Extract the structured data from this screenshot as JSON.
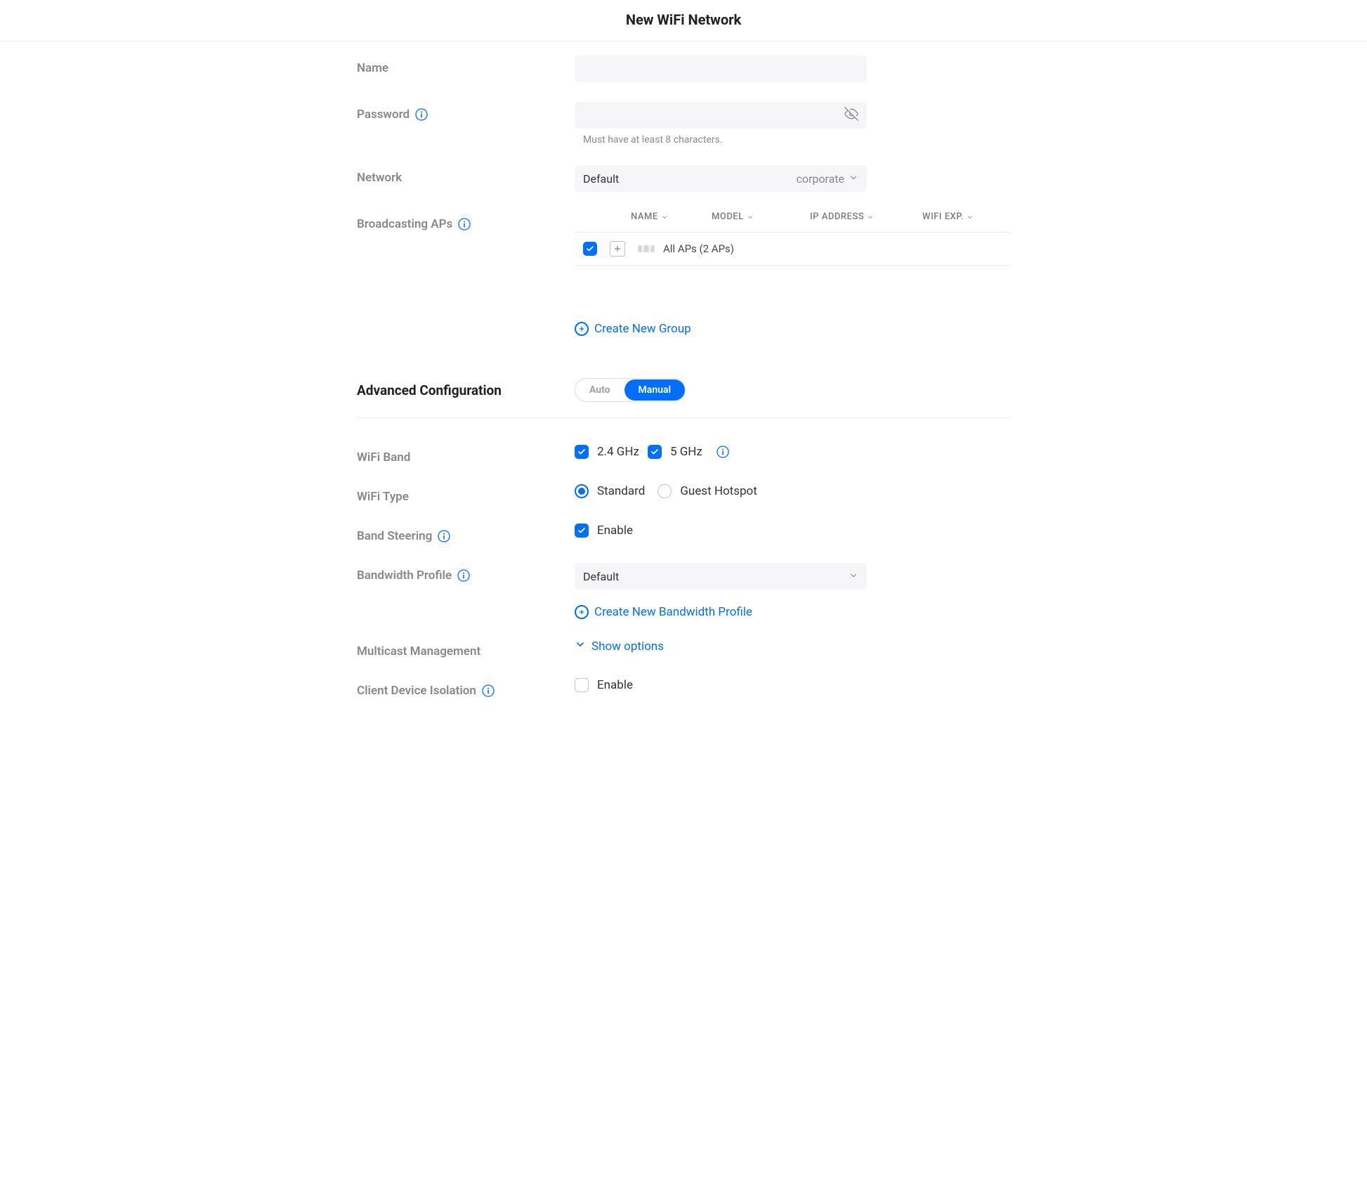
{
  "header": {
    "title": "New WiFi Network"
  },
  "labels": {
    "name": "Name",
    "password": "Password",
    "network": "Network",
    "broadcasting_aps": "Broadcasting APs",
    "advanced_config": "Advanced Configuration",
    "wifi_band": "WiFi Band",
    "wifi_type": "WiFi Type",
    "band_steering": "Band Steering",
    "bandwidth_profile": "Bandwidth Profile",
    "multicast": "Multicast Management",
    "client_isolation": "Client Device Isolation"
  },
  "name": {
    "value": ""
  },
  "password": {
    "value": "",
    "helper": "Must have at least 8 characters."
  },
  "network": {
    "value": "Default",
    "tag": "corporate"
  },
  "aps": {
    "columns": {
      "name": "NAME",
      "model": "MODEL",
      "ip": "IP ADDRESS",
      "exp": "WIFI EXP."
    },
    "all_label": "All APs (2 APs)",
    "create_group": "Create New Group"
  },
  "adv_mode": {
    "auto": "Auto",
    "manual": "Manual"
  },
  "wifi_band": {
    "b24": "2.4 GHz",
    "b5": "5 GHz"
  },
  "wifi_type": {
    "standard": "Standard",
    "guest": "Guest Hotspot"
  },
  "enable_label": "Enable",
  "bandwidth": {
    "value": "Default",
    "create_new": "Create New Bandwidth Profile"
  },
  "multicast": {
    "show_options": "Show options"
  }
}
